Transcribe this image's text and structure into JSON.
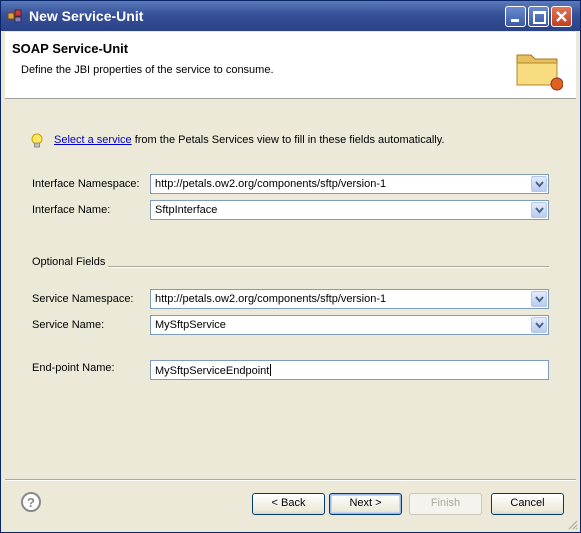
{
  "window": {
    "title": "New Service-Unit",
    "controls": {
      "minimize": "minimize-icon",
      "maximize": "maximize-icon",
      "close": "close-icon"
    }
  },
  "banner": {
    "title": "SOAP Service-Unit",
    "description": "Define the JBI properties of the service to consume.",
    "icon": "folder-icon"
  },
  "hint": {
    "icon": "lightbulb-icon",
    "link_text": "Select a service",
    "rest_text": " from the Petals Services view to fill in these fields automatically."
  },
  "fields": {
    "interface_namespace": {
      "label": "Interface Namespace:",
      "value": "http://petals.ow2.org/components/sftp/version-1"
    },
    "interface_name": {
      "label": "Interface Name:",
      "value": "SftpInterface"
    },
    "optional_header": "Optional Fields",
    "service_namespace": {
      "label": "Service Namespace:",
      "value": "http://petals.ow2.org/components/sftp/version-1"
    },
    "service_name": {
      "label": "Service Name:",
      "value": "MySftpService"
    },
    "endpoint_name": {
      "label": "End-point Name:",
      "value": "MySftpServiceEndpoint"
    }
  },
  "buttons": {
    "help": "?",
    "back": "< Back",
    "next": "Next >",
    "finish": "Finish",
    "cancel": "Cancel"
  },
  "colors": {
    "titlebar": "#36509a",
    "dialog_bg": "#ece9d8",
    "link": "#0000cc"
  }
}
